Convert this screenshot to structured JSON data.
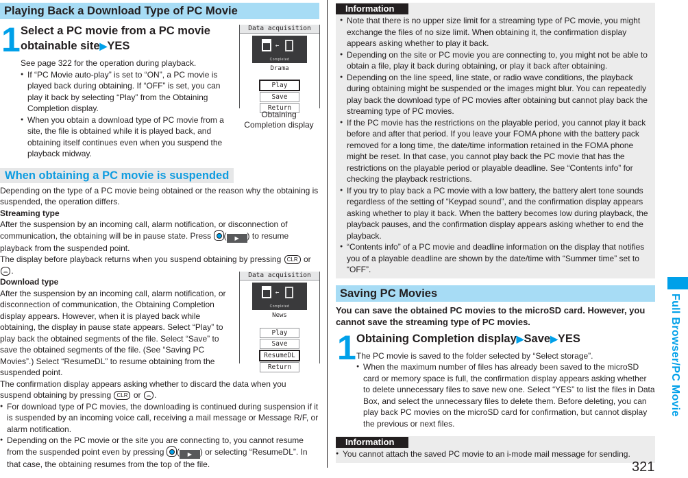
{
  "left": {
    "section1": {
      "title": "Playing Back a Download Type of PC Movie",
      "step": {
        "number": "1",
        "title_line1": "Select a PC movie from a PC movie",
        "title_line2": "obtainable site",
        "title_arrow": "▶",
        "title_end": "YES",
        "intro": "See page 322 for the operation during playback.",
        "bullets": [
          "If “PC Movie auto-play” is set to “ON”, a PC movie is played back during obtaining. If “OFF” is set, you can play it back by selecting “Play” from the Obtaining Completion display.",
          "When you obtain a download type of PC movie from a site, the file is obtained while it is played back, and obtaining itself continues even when you suspend the playback midway."
        ]
      },
      "screen": {
        "title": "Data acquisition",
        "icon_label": "Completed",
        "name": "Drama",
        "buttons": [
          "Play",
          "Save",
          "Return"
        ],
        "selected": "Play",
        "caption_line1": "Obtaining",
        "caption_line2": "Completion display"
      }
    },
    "section2": {
      "title": "When obtaining a PC movie is suspended",
      "intro": "Depending on the type of a PC movie being obtained or the reason why the obtaining is suspended, the operation differs.",
      "streaming": {
        "heading": "Streaming type",
        "text_a": "After the suspension by an incoming call, alarm notification, or disconnection of communication, the obtaining will be in pause state. Press",
        "text_b": "to resume playback from the suspended point.",
        "text_c": "The display before playback returns when you suspend obtaining by pressing",
        "text_d": "or",
        "text_e": "."
      },
      "download": {
        "heading": "Download type",
        "text": "After the suspension by an incoming call, alarm notification, or disconnection of communication, the Obtaining Completion display appears. However, when it is played back while obtaining, the display in pause state appears. Select “Play” to play back the obtained segments of the file. Select “Save” to save the obtained segments of the file. (See “Saving PC Movies”.) Select “ResumeDL” to resume obtaining from the suspended point.",
        "confirm_a": "The confirmation display appears asking whether to discard the data when you suspend obtaining by pressing",
        "confirm_b": "or",
        "confirm_c": ".",
        "bullet1": "For download type of PC movies, the downloading is continued during suspension if it is suspended by an incoming voice call, receiving a mail message or Message R/F, or alarm notification.",
        "bullet2_a": "Depending on the PC movie or the site you are connecting to, you cannot resume from the suspended point even by pressing",
        "bullet2_b": "or selecting “ResumeDL”. In that case, the obtaining resumes from the top of the file."
      },
      "screen": {
        "title": "Data acquisition",
        "icon_label": "Completed",
        "name": "News",
        "buttons": [
          "Play",
          "Save",
          "ResumeDL",
          "Return"
        ],
        "selected": "ResumeDL"
      }
    },
    "keys": {
      "clr": "CLR",
      "end": "⌓",
      "play": "▶",
      "open_paren": "(",
      "close_paren": ")"
    }
  },
  "right": {
    "info1": {
      "label": "Information",
      "bullets": [
        "Note that there is no upper size limit for a streaming type of PC movie, you might exchange the files of no size limit. When obtaining it, the confirmation display appears asking whether to play it back.",
        "Depending on the site or PC movie you are connecting to, you might not be able to obtain a file, play it back during obtaining, or play it back after obtaining.",
        "Depending on the line speed, line state, or radio wave conditions, the playback during obtaining might be suspended or the images might blur. You can repeatedly play back the download type of PC movies after obtaining but cannot play back the streaming type of PC movies.",
        "If the PC movie has the restrictions on the playable period, you cannot play it back before and after that period. If you leave your FOMA phone with the battery pack removed for a long time, the date/time information retained in the FOMA phone might be reset. In that case, you cannot play back the PC movie that has the restrictions on the playable period or playable deadline. See “Contents info” for checking the playback restrictions.",
        "If you try to play back a PC movie with a low battery, the battery alert tone sounds regardless of the setting of “Keypad sound”, and the confirmation display appears asking whether to play it back. When the battery becomes low during playback, the playback pauses, and the confirmation display appears asking whether to end the playback.",
        "“Contents info” of a PC movie and deadline information on the display that notifies you of a playable deadline are shown by the date/time with “Summer time” set to “OFF”."
      ]
    },
    "section3": {
      "title": "Saving PC Movies",
      "lead": "You can save the obtained PC movies to the microSD card. However, you cannot save the streaming type of PC movies.",
      "step": {
        "number": "1",
        "part1": "Obtaining Completion display",
        "part2": "Save",
        "part3": "YES",
        "arrow": "▶",
        "text": "The PC movie is saved to the folder selected by “Select storage”.",
        "bullet": "When the maximum number of files has already been saved to the microSD card or memory space is full, the confirmation display appears asking whether to delete unnecessary files to save new one. Select “YES” to list the files in Data Box, and select the unnecessary files to delete them. Before deleting, you can play back PC movies on the microSD card for confirmation, but cannot display the previous or next files."
      }
    },
    "info2": {
      "label": "Information",
      "bullets": [
        "You cannot attach the saved PC movie to an i-mode mail message for sending."
      ]
    }
  },
  "side_tab": {
    "label": "Full Browser/PC Movie",
    "color": "#00a0e9"
  },
  "page_number": "321",
  "colors": {
    "accent": "#00a0e9",
    "section_bg": "#a7dcf5",
    "info_bg": "#ececec",
    "text": "#231f20"
  }
}
